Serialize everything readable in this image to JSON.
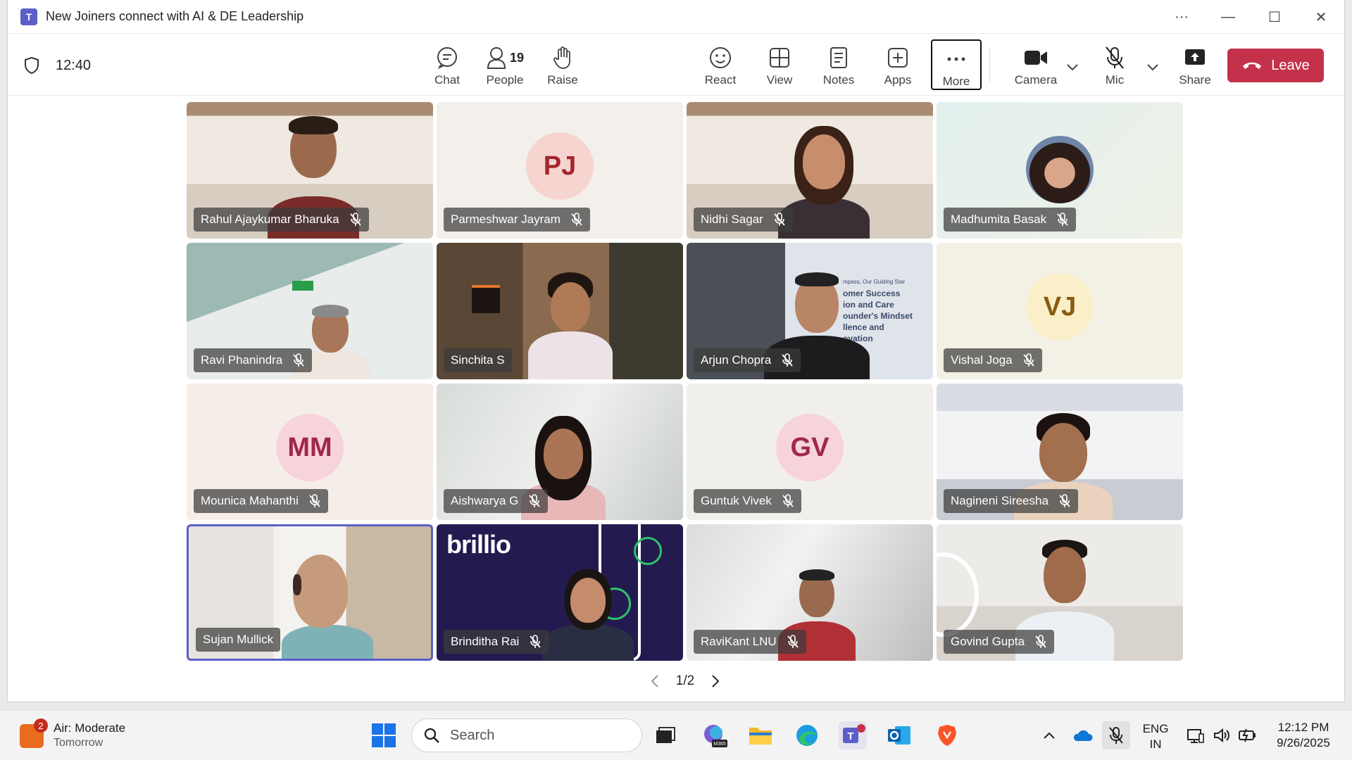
{
  "window": {
    "app_icon": "teams-icon",
    "title": "New Joiners connect with AI & DE Leadership"
  },
  "meeting": {
    "elapsed": "12:40"
  },
  "toolbar": {
    "chat": "Chat",
    "people": "People",
    "people_count": "19",
    "raise": "Raise",
    "react": "React",
    "view": "View",
    "notes": "Notes",
    "apps": "Apps",
    "more": "More",
    "camera": "Camera",
    "mic": "Mic",
    "share": "Share",
    "leave": "Leave"
  },
  "participants": [
    {
      "name": "Rahul Ajaykumar Bharuka",
      "type": "video"
    },
    {
      "name": "Parmeshwar Jayram",
      "type": "avatar",
      "initials": "PJ"
    },
    {
      "name": "Nidhi Sagar",
      "type": "video"
    },
    {
      "name": "Madhumita Basak",
      "type": "photo"
    },
    {
      "name": "Ravi Phanindra",
      "type": "video"
    },
    {
      "name": "Sinchita S",
      "type": "video"
    },
    {
      "name": "Arjun Chopra",
      "type": "video"
    },
    {
      "name": "Vishal Joga",
      "type": "avatar",
      "initials": "VJ"
    },
    {
      "name": "Mounica Mahanthi",
      "type": "avatar",
      "initials": "MM"
    },
    {
      "name": "Aishwarya G",
      "type": "video"
    },
    {
      "name": "Guntuk Vivek",
      "type": "avatar",
      "initials": "GV"
    },
    {
      "name": "Nagineni Sireesha",
      "type": "video"
    },
    {
      "name": "Sujan Mullick",
      "type": "video",
      "speaking": true
    },
    {
      "name": "Brinditha Rai",
      "type": "video",
      "background_text": "brillio"
    },
    {
      "name": "RaviKant LNU",
      "type": "video"
    },
    {
      "name": "Govind Gupta",
      "type": "video"
    }
  ],
  "backgrounds": {
    "arjun_wall_text": [
      "mpass, Our Guiding Star",
      "omer Success",
      "ion and Care",
      "ounder's Mindset",
      "llence and",
      "ovation"
    ]
  },
  "pager": {
    "label": "1/2"
  },
  "taskbar": {
    "weather_badge": "2",
    "weather_line1": "Air: Moderate",
    "weather_line2": "Tomorrow",
    "search_placeholder": "Search",
    "language_line1": "ENG",
    "language_line2": "IN",
    "time": "12:12 PM",
    "date": "9/26/2025",
    "m365_label": "M365"
  },
  "colors": {
    "leave": "#c4314b",
    "accent": "#5b5fc7",
    "active_border": "#5b5fc7"
  }
}
